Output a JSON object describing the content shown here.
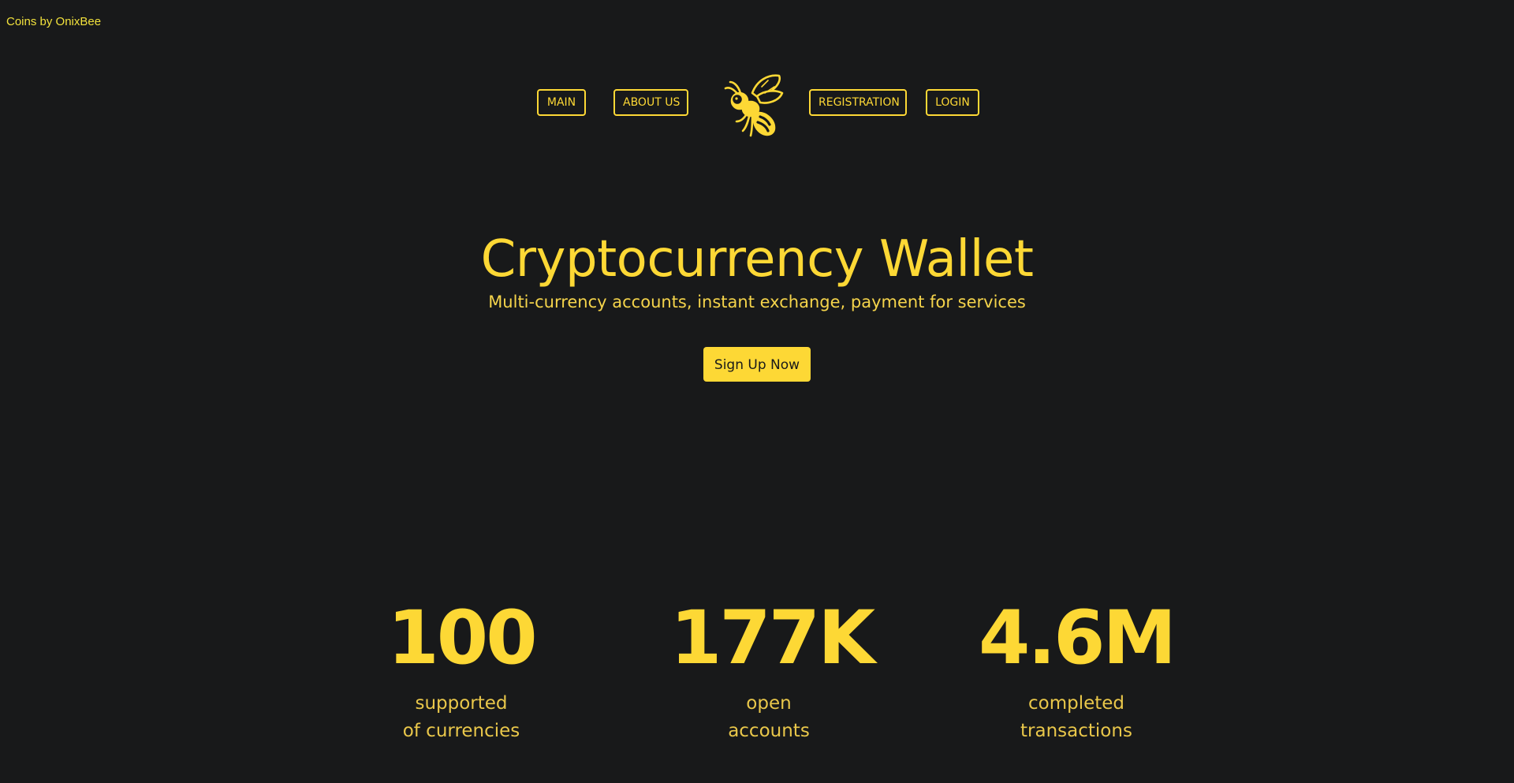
{
  "brand": {
    "label": "Coins by OnixBee"
  },
  "colors": {
    "background": "#18191a",
    "accent": "#fdd835",
    "brand_text": "#f2e23c"
  },
  "nav": {
    "main": "MAIN",
    "about": "ABOUT US",
    "logo_icon": "bee-icon",
    "registration": "REGISTRATION",
    "login": "LOGIN"
  },
  "hero": {
    "title": "Cryptocurrency Wallet",
    "subtitle": "Multi-currency accounts, instant exchange, payment for services",
    "cta_label": "Sign Up Now"
  },
  "stats": [
    {
      "value": "100",
      "label_line1": "supported",
      "label_line2": "of currencies"
    },
    {
      "value": "177K",
      "label_line1": "open",
      "label_line2": "accounts"
    },
    {
      "value": "4.6M",
      "label_line1": "completed",
      "label_line2": "transactions"
    }
  ]
}
